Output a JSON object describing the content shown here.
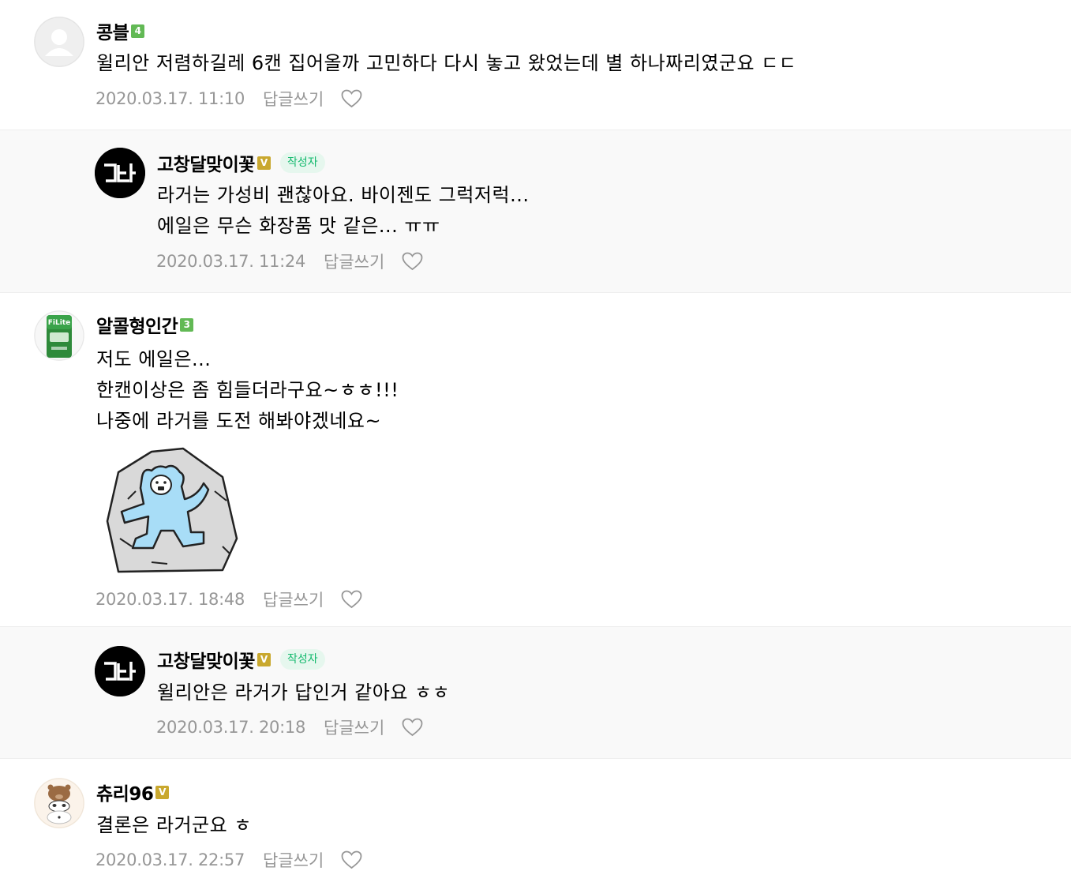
{
  "comments": [
    {
      "nickname": "콩블",
      "level_badge": "4",
      "text": "윌리안 저렴하길레 6캔 집어올까 고민하다 다시 놓고 왔었는데 별 하나짜리였군요 ㄷㄷ",
      "date": "2020.03.17. 11:10",
      "reply_label": "답글쓰기"
    },
    {
      "nickname": "고창달맞이꽃",
      "level_badge": "V",
      "author_badge": "작성자",
      "avatar_text": "그딤",
      "lines": [
        "라거는 가성비 괜찮아요. 바이젠도 그럭저럭...",
        "에일은 무슨 화장품 맛 같은... ㅠㅠ"
      ],
      "date": "2020.03.17. 11:24",
      "reply_label": "답글쓰기"
    },
    {
      "nickname": "알콜형인간",
      "level_badge": "3",
      "avatar_text": "FiLite",
      "lines": [
        "저도 에일은...",
        "한캔이상은 좀 힘들더라구요~ㅎㅎ!!!",
        "나중에 라거를 도전 해봐야겠네요~"
      ],
      "date": "2020.03.17. 18:48",
      "reply_label": "답글쓰기"
    },
    {
      "nickname": "고창달맞이꽃",
      "level_badge": "V",
      "author_badge": "작성자",
      "avatar_text": "그딤",
      "text": "윌리안은 라거가 답인거 같아요 ㅎㅎ",
      "date": "2020.03.17. 20:18",
      "reply_label": "답글쓰기"
    },
    {
      "nickname": "츄리96",
      "level_badge": "V",
      "text": "결론은 라거군요 ㅎ",
      "date": "2020.03.17. 22:57",
      "reply_label": "답글쓰기"
    }
  ],
  "colors": {
    "meta_text": "#979797",
    "author_badge_text": "#13b96d",
    "author_badge_bg": "#e6f7ee",
    "level_green": "#62b955",
    "level_gold": "#c9a82e",
    "reply_bg": "#f9f9f9"
  },
  "icons": {
    "default_avatar": "person-silhouette-icon",
    "like": "heart-outline-icon",
    "sticker": "blue-bear-in-rock-sticker"
  }
}
